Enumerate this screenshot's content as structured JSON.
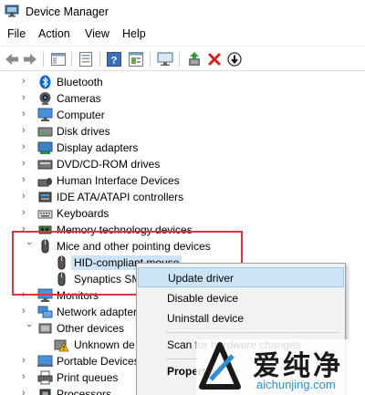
{
  "window": {
    "title": "Device Manager"
  },
  "menu": [
    "File",
    "Action",
    "View",
    "Help"
  ],
  "toolbar": [
    "back-icon",
    "forward-icon",
    "show-hide-tree-icon",
    "properties-icon",
    "help-icon",
    "view-icon",
    "monitor-scan-icon",
    "update-driver-icon",
    "uninstall-icon",
    "disable-icon"
  ],
  "tree": {
    "items": [
      {
        "label": "Bluetooth",
        "icon": "bluetooth-icon"
      },
      {
        "label": "Cameras",
        "icon": "camera-icon"
      },
      {
        "label": "Computer",
        "icon": "computer-icon"
      },
      {
        "label": "Disk drives",
        "icon": "disk-drive-icon"
      },
      {
        "label": "Display adapters",
        "icon": "display-adapter-icon"
      },
      {
        "label": "DVD/CD-ROM drives",
        "icon": "dvd-drive-icon"
      },
      {
        "label": "Human Interface Devices",
        "icon": "hid-icon"
      },
      {
        "label": "IDE ATA/ATAPI controllers",
        "icon": "ide-controller-icon"
      },
      {
        "label": "Keyboards",
        "icon": "keyboard-icon"
      },
      {
        "label": "Memory technology devices",
        "icon": "memory-icon"
      },
      {
        "label": "Mice and other pointing devices",
        "icon": "mouse-icon"
      },
      {
        "label": "HID-compliant mouse",
        "icon": "mouse-icon"
      },
      {
        "label": "Synaptics SM",
        "icon": "mouse-icon"
      },
      {
        "label": "Monitors",
        "icon": "monitor-icon"
      },
      {
        "label": "Network adapters",
        "icon": "network-adapter-icon"
      },
      {
        "label": "Other devices",
        "icon": "other-devices-icon"
      },
      {
        "label": "Unknown de",
        "icon": "unknown-device-warning-icon"
      },
      {
        "label": "Portable Devices",
        "icon": "portable-device-icon"
      },
      {
        "label": "Print queues",
        "icon": "printer-icon"
      },
      {
        "label": "Processors",
        "icon": "processor-icon"
      }
    ]
  },
  "context_menu": {
    "items": [
      "Update driver",
      "Disable device",
      "Uninstall device",
      "Scan for hardware changes",
      "Properties"
    ]
  },
  "watermark": {
    "brand": "爱纯净",
    "url": "aichunjing.com"
  },
  "colors": {
    "selection": "#cde3f7",
    "callout": "#d9363e",
    "menu_hover": "#cce4f7"
  }
}
